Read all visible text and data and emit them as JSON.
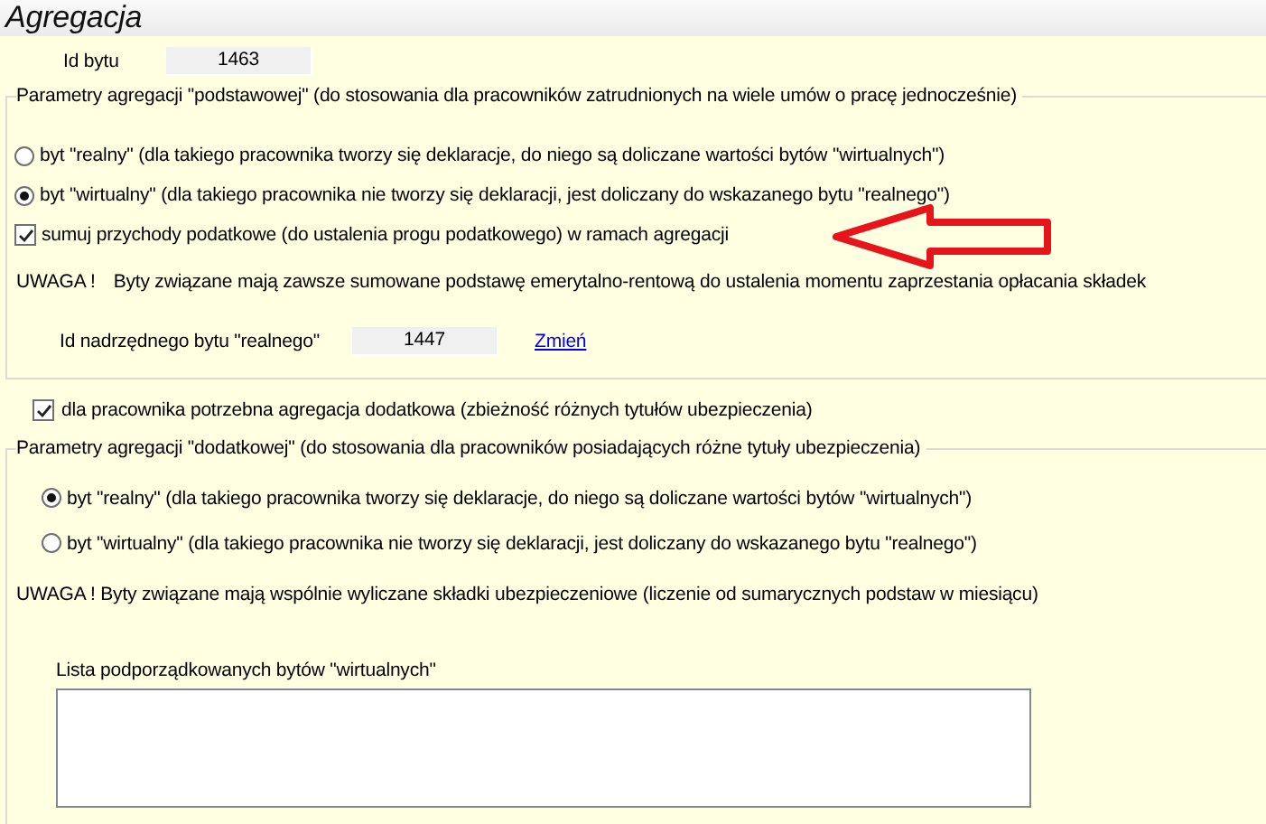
{
  "title": "Agregacja",
  "id_field": {
    "label": "Id bytu",
    "value": "1463"
  },
  "basic_group": {
    "legend": "Parametry agregacji \"podstawowej\" (do stosowania dla pracowników zatrudnionych na wiele umów o pracę jednocześnie)",
    "options": [
      {
        "label": "byt \"realny\" (dla takiego pracownika tworzy się deklaracje, do niego są doliczane wartości bytów \"wirtualnych\")",
        "selected": false
      },
      {
        "label": "byt \"wirtualny\" (dla takiego pracownika nie tworzy się deklaracji, jest doliczany do wskazanego bytu \"realnego\")",
        "selected": true
      }
    ],
    "sum_checkbox": {
      "label": "sumuj przychody podatkowe (do ustalenia progu podatkowego) w ramach agregacji",
      "checked": true
    },
    "warning_label": "UWAGA !",
    "warning_text": "Byty związane mają zawsze sumowane podstawę emerytalno-rentową do ustalenia momentu zaprzestania opłacania składek",
    "parent_id": {
      "label": "Id nadrzędnego bytu \"realnego\"",
      "value": "1447"
    },
    "change_link": "Zmień"
  },
  "extra_checkbox": {
    "label": "dla pracownika potrzebna agregacja dodatkowa (zbieżność różnych tytułów ubezpieczenia)",
    "checked": true
  },
  "extra_group": {
    "legend": "Parametry agregacji \"dodatkowej\" (do stosowania dla pracowników posiadających różne tytuły ubezpieczenia)",
    "options": [
      {
        "label": "byt \"realny\" (dla takiego pracownika tworzy się deklaracje, do niego są doliczane wartości bytów \"wirtualnych\")",
        "selected": true
      },
      {
        "label": "byt \"wirtualny\" (dla takiego pracownika nie tworzy się deklaracji, jest doliczany do wskazanego bytu \"realnego\")",
        "selected": false
      }
    ],
    "warning": "UWAGA ! Byty związane mają wspólnie wyliczane składki ubezpieczeniowe (liczenie od sumarycznych podstaw w miesiącu)",
    "list_label": "Lista podporządkowanych bytów \"wirtualnych\""
  }
}
